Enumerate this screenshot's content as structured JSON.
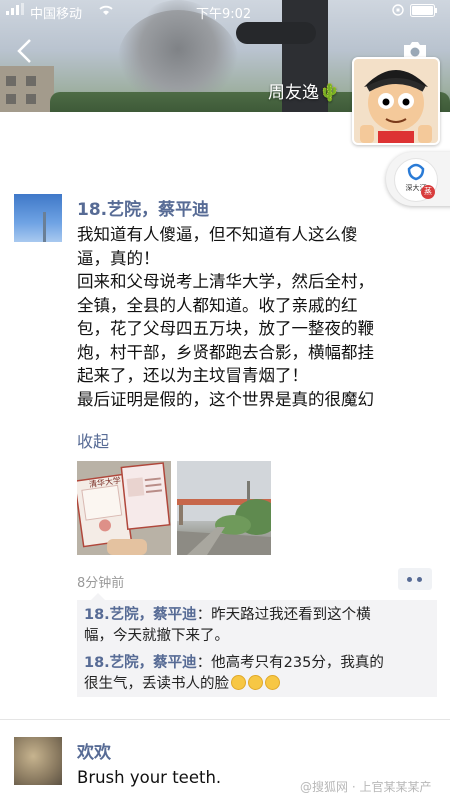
{
  "status_bar": {
    "carrier": "中国移动",
    "time": "下午9:02"
  },
  "cover": {
    "name": "周友逸🌵"
  },
  "badge": {
    "text": "深大汀",
    "dot": "蒸"
  },
  "post": {
    "author": "18.艺院，蔡平迪",
    "text": "我知道有人傻逼，但不知道有人这么傻\n逼，真的！\n回来和父母说考上清华大学，然后全村，\n全镇，全县的人都知道。收了亲戚的红\n包，花了父母四五万块，放了一整夜的鞭\n炮，村干部，乡贤都跑去合影，横幅都挂\n起来了，还以为主坟冒青烟了！\n最后证明是假的，这个世界是真的很魔幻",
    "collapse_label": "收起",
    "photo_text": "清华大学",
    "time": "8分钟前",
    "comments": [
      {
        "name": "18.艺院，蔡平迪",
        "text": "：昨天路过我还看到这个横\n幅，今天就撤下来了。"
      },
      {
        "name": "18.艺院，蔡平迪",
        "text": "：他高考只有235分，我真的\n很生气，丢读书人的脸"
      }
    ]
  },
  "next_post": {
    "author": "欢欢",
    "text": "Brush your teeth."
  },
  "watermark": "@搜狐网 · 上官某某某产"
}
